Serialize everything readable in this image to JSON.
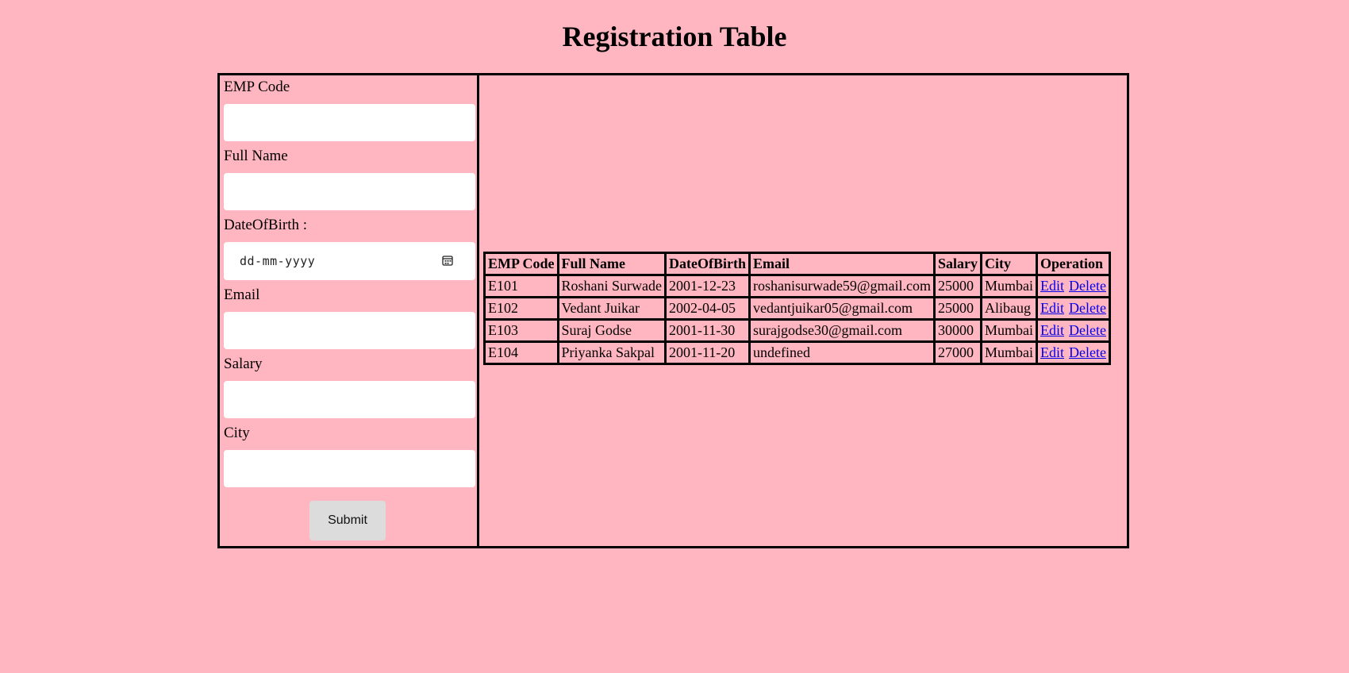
{
  "page": {
    "title": "Registration Table"
  },
  "form": {
    "fields": [
      {
        "label": "EMP Code",
        "value": "",
        "placeholder": ""
      },
      {
        "label": "Full Name",
        "value": "",
        "placeholder": ""
      },
      {
        "label": "DateOfBirth :",
        "value": "",
        "placeholder": "dd-mm-yyyy"
      },
      {
        "label": "Email",
        "value": "",
        "placeholder": ""
      },
      {
        "label": "Salary",
        "value": "",
        "placeholder": ""
      },
      {
        "label": "City",
        "value": "",
        "placeholder": ""
      }
    ],
    "submit_label": "Submit",
    "calendar_icon": "calendar-icon"
  },
  "table": {
    "headers": [
      "EMP Code",
      "Full Name",
      "DateOfBirth",
      "Email",
      "Salary",
      "City",
      "Operation"
    ],
    "rows": [
      {
        "emp_code": "E101",
        "full_name": "Roshani Surwade",
        "dob": "2001-12-23",
        "email": "roshanisurwade59@gmail.com",
        "salary": "25000",
        "city": "Mumbai",
        "edit": "Edit",
        "delete": "Delete"
      },
      {
        "emp_code": "E102",
        "full_name": "Vedant Juikar",
        "dob": "2002-04-05",
        "email": "vedantjuikar05@gmail.com",
        "salary": "25000",
        "city": "Alibaug",
        "edit": "Edit",
        "delete": "Delete"
      },
      {
        "emp_code": "E103",
        "full_name": "Suraj Godse",
        "dob": "2001-11-30",
        "email": "surajgodse30@gmail.com",
        "salary": "30000",
        "city": "Mumbai",
        "edit": "Edit",
        "delete": "Delete"
      },
      {
        "emp_code": "E104",
        "full_name": "Priyanka Sakpal",
        "dob": "2001-11-20",
        "email": "undefined",
        "salary": "27000",
        "city": "Mumbai",
        "edit": "Edit",
        "delete": "Delete"
      }
    ]
  },
  "colors": {
    "background": "#ffb6c1",
    "link": "#0000ee",
    "button": "#dcdcdc"
  }
}
